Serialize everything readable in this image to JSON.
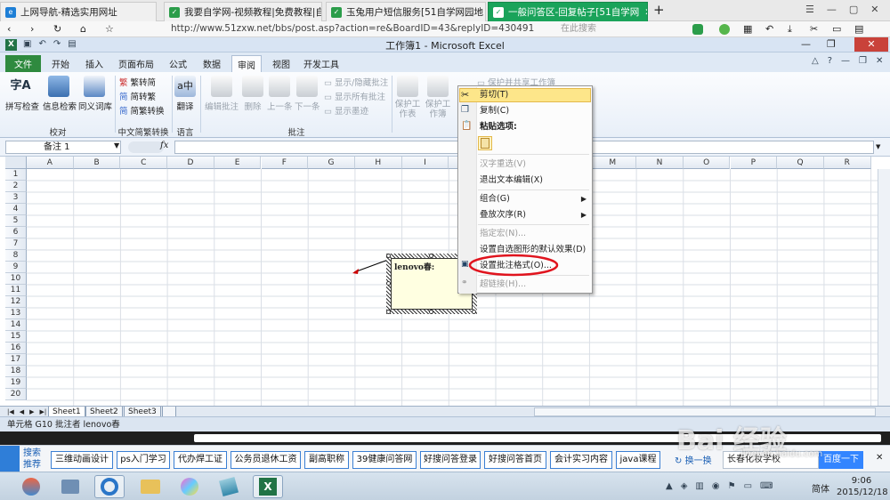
{
  "browser": {
    "tabs": [
      {
        "label": "上网导航-精选实用网址",
        "active": false
      },
      {
        "label": "我要自学网-视频教程|免费教程|自",
        "active": false
      },
      {
        "label": "玉兔用户短信服务[51自学网园地",
        "active": false
      },
      {
        "label": "一般问答区-回复帖子[51自学网",
        "active": true
      }
    ],
    "new_tab": "+",
    "url": "http://www.51zxw.net/bbs/post.asp?action=re&BoardID=43&replyID=430491",
    "search_placeholder": "在此搜索",
    "window_controls": [
      "☰",
      "—",
      "▢",
      "✕"
    ]
  },
  "excel": {
    "title": "工作簿1 - Microsoft Excel",
    "ribbon_tabs": [
      "文件",
      "开始",
      "插入",
      "页面布局",
      "公式",
      "数据",
      "审阅",
      "视图",
      "开发工具"
    ],
    "active_tab": "审阅",
    "ribbon": {
      "proofing": {
        "spell": "拼写检查",
        "research": "信息检索",
        "thesaurus": "同义词库",
        "group": "校对"
      },
      "chinese": {
        "to_simplified": "繁转简",
        "to_traditional": "简转繁",
        "convert": "简繁转换",
        "group": "中文简繁转换"
      },
      "language": {
        "translate": "翻译",
        "group": "语言"
      },
      "comments": {
        "edit": "编辑批注",
        "delete": "删除",
        "prev": "上一条",
        "next": "下一条",
        "show_hide": "显示/隐藏批注",
        "show_all": "显示所有批注",
        "show_ink": "显示墨迹",
        "group": "批注"
      },
      "changes": {
        "protect_sheet": "保护工作表",
        "protect_book": "保护工作簿",
        "protect_share": "保护并共享工作簿"
      }
    },
    "name_box": "备注 1",
    "fx": "fx",
    "columns": [
      "A",
      "B",
      "C",
      "D",
      "E",
      "F",
      "G",
      "H",
      "I",
      "J",
      "K",
      "L",
      "M",
      "N",
      "O",
      "P",
      "Q",
      "R"
    ],
    "rows": [
      "1",
      "2",
      "3",
      "4",
      "5",
      "6",
      "7",
      "8",
      "9",
      "10",
      "11",
      "12",
      "13",
      "14",
      "15",
      "16",
      "17",
      "18",
      "19",
      "20"
    ],
    "comment_text": "lenovo春:",
    "sheets": [
      "Sheet1",
      "Sheet2",
      "Sheet3"
    ],
    "status_text": "单元格 G10 批注者 lenovo春"
  },
  "context_menu": {
    "items": [
      {
        "label": "剪切(T)",
        "disabled": false,
        "highlighted": true,
        "icon": "scissors-icon"
      },
      {
        "label": "复制(C)",
        "disabled": false,
        "icon": "copy-icon"
      },
      {
        "label": "粘贴选项:",
        "disabled": false,
        "bold": true,
        "icon": "paste-icon"
      },
      {
        "label": "汉字重选(V)",
        "disabled": true
      },
      {
        "label": "退出文本编辑(X)",
        "disabled": false
      },
      {
        "label": "组合(G)",
        "disabled": false,
        "submenu": true
      },
      {
        "label": "叠放次序(R)",
        "disabled": false,
        "submenu": true
      },
      {
        "label": "指定宏(N)...",
        "disabled": true
      },
      {
        "label": "设置自选图形的默认效果(D)",
        "disabled": false
      },
      {
        "label": "设置批注格式(O)...",
        "disabled": false,
        "icon": "format-icon"
      },
      {
        "label": "超链接(H)...",
        "disabled": true,
        "icon": "link-icon"
      }
    ]
  },
  "search_bar": {
    "label": "搜索推荐",
    "tags": [
      "三维动画设计",
      "ps入门学习",
      "代办焊工证",
      "公务员退休工资",
      "副高职称",
      "39健康问答网",
      "好搜问答登录",
      "好搜问答首页",
      "会计实习内容",
      "java课程"
    ],
    "refresh": "换一换",
    "input_value": "长春化妆学校",
    "submit": "百度一下"
  },
  "taskbar": {
    "ime": "简体",
    "time": "9:06",
    "date": "2015/12/18"
  },
  "watermark": {
    "text": "Bai 经验",
    "sub": "jingyan.baidu.com"
  },
  "colors": {
    "accent_green": "#1aa35a",
    "excel_file_tab": "#2f8a3f",
    "highlight": "#fde68a",
    "red_circle": "#e0141e"
  }
}
